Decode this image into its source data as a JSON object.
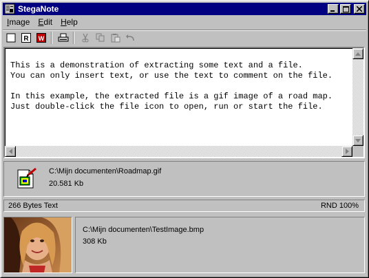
{
  "window": {
    "title": "StegaNote"
  },
  "menu": [
    {
      "label": "Image",
      "accel": "I",
      "rest": "mage"
    },
    {
      "label": "Edit",
      "accel": "E",
      "rest": "dit"
    },
    {
      "label": "Help",
      "accel": "H",
      "rest": "elp"
    }
  ],
  "toolbar": {
    "buttons": [
      "new-icon",
      "read-icon",
      "write-icon",
      "print-icon",
      "cut-icon",
      "copy-icon",
      "paste-icon",
      "undo-icon"
    ],
    "read_letter": "R",
    "write_letter": "W"
  },
  "editor": {
    "text": "This is a demonstration of extracting some text and a file.\nYou can only insert text, or use the text to comment on the file.\n\nIn this example, the extracted file is a gif image of a road map.\nJust double-click the file icon to open, run or start the file."
  },
  "extracted_file": {
    "path": "C:\\Mijn documenten\\Roadmap.gif",
    "size": "20.581 Kb"
  },
  "status": {
    "left": "266 Bytes Text",
    "right": "RND 100%"
  },
  "carrier_image": {
    "path": "C:\\Mijn documenten\\TestImage.bmp",
    "size": "308 Kb"
  },
  "colors": {
    "titlebar": "#000080",
    "face": "#c0c0c0",
    "write_icon": "#c00000"
  }
}
